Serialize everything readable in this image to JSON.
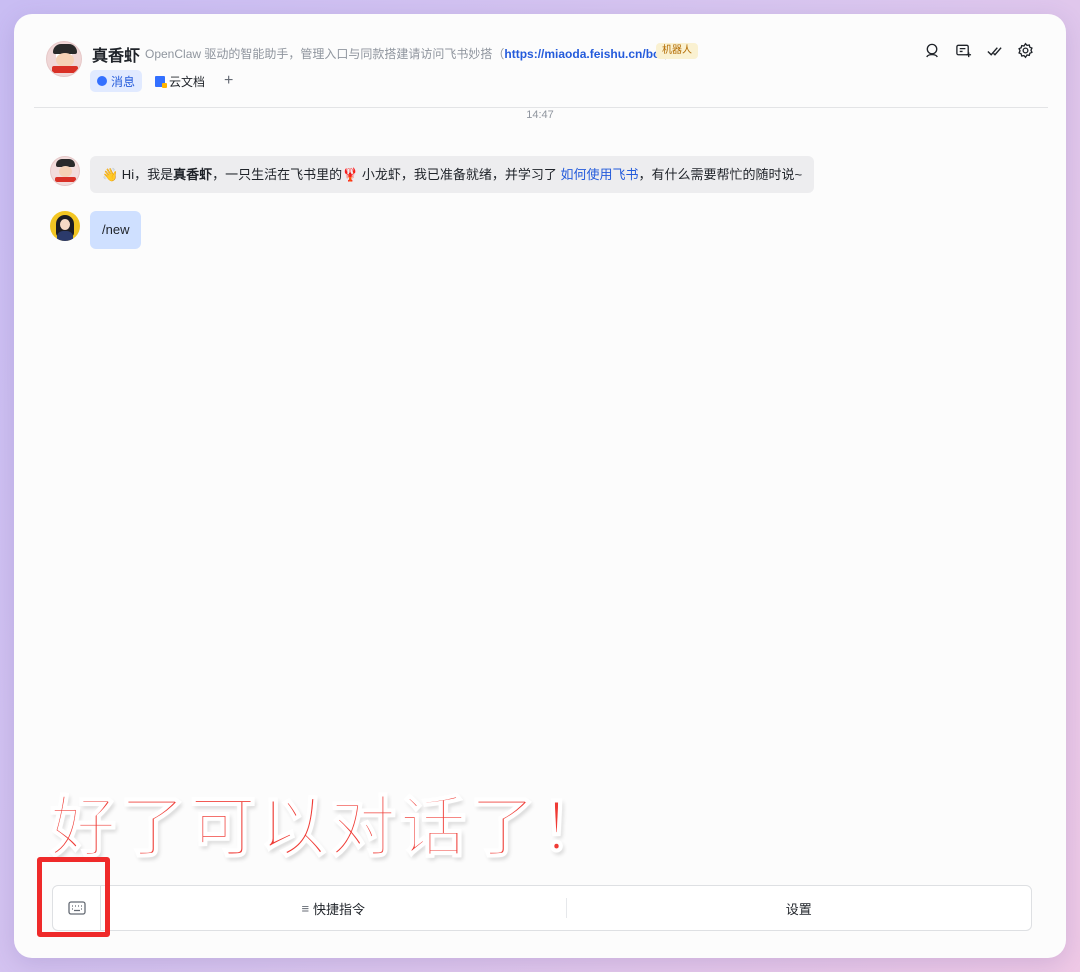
{
  "header": {
    "bot_name": "真香虾",
    "description_prefix": "OpenClaw 驱动的智能助手，管理入口与同款搭建请访问飞书妙搭（",
    "description_link": "https://miaoda.feishu.cn/bot",
    "description_suffix": "）",
    "robot_badge": "机器人",
    "tabs": [
      {
        "label": "消息",
        "icon": "message-icon",
        "active": true
      },
      {
        "label": "云文档",
        "icon": "doc-icon",
        "active": false
      }
    ],
    "add_tab": "+",
    "icons": [
      "search-member-icon",
      "add-chat-icon",
      "pin-check-icon",
      "settings-gear-icon"
    ]
  },
  "chat": {
    "timestamp": "14:47",
    "messages": [
      {
        "sender": "bot",
        "emoji_wave": "👋",
        "text_a": " Hi，我是",
        "text_bold": "真香虾",
        "text_b": "，一只生活在飞书里的",
        "emoji_lobster": "🦞",
        "text_c": " 小龙虾，我已准备就绪，并学习了 ",
        "link": "如何使用飞书",
        "text_d": "，有什么需要帮忙的随时说~"
      },
      {
        "sender": "user",
        "text": "/new"
      }
    ]
  },
  "annotation": {
    "caption": "好了可以对话了！",
    "highlight_color": "#ef2a2a"
  },
  "bottom_bar": {
    "keyboard_icon": "keyboard-icon",
    "menu_glyph": "≡",
    "quick_commands": "快捷指令",
    "settings": "设置"
  },
  "colors": {
    "accent": "#3370ff",
    "link": "#245bdb",
    "user_bubble": "#cfe0ff",
    "bot_bubble": "#ededef"
  }
}
